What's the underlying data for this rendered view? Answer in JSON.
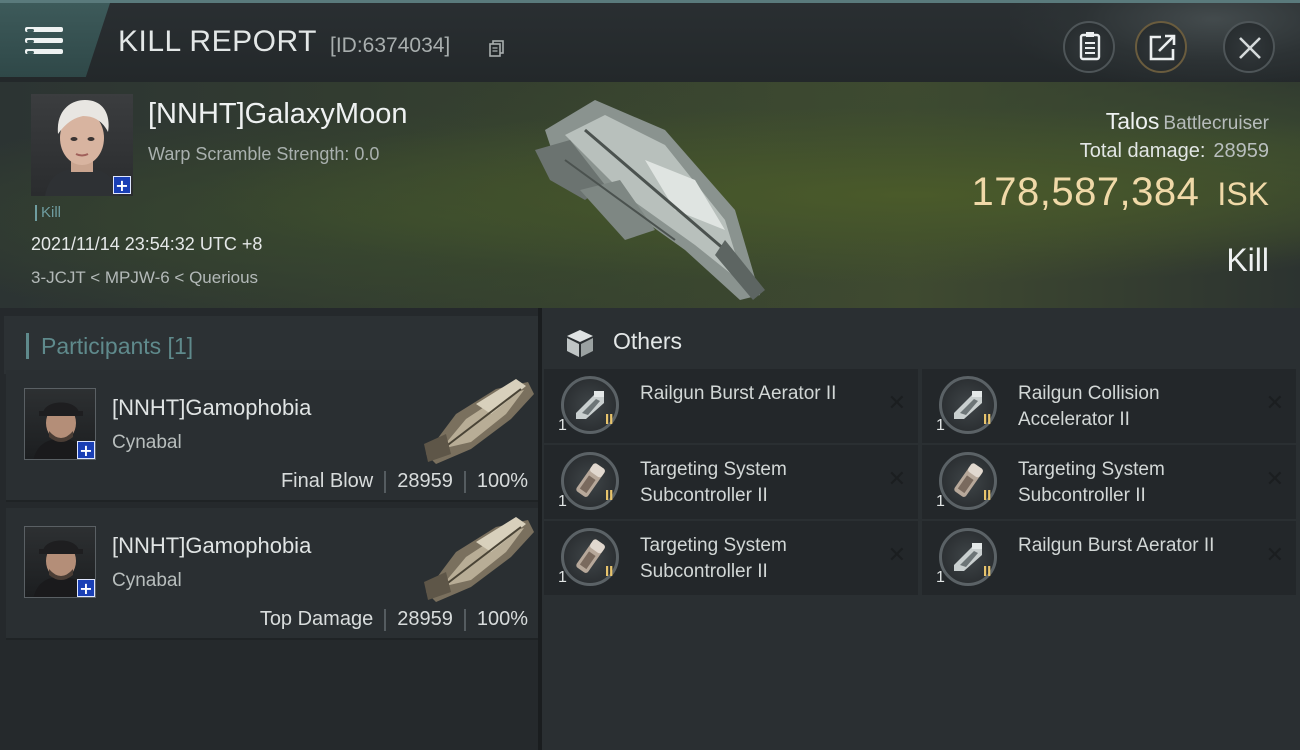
{
  "header": {
    "title": "KILL REPORT",
    "report_id": "[ID:6374034]",
    "icons": [
      "menu-icon",
      "copy-icon",
      "clipboard-icon",
      "share-icon",
      "close-icon"
    ]
  },
  "victim": {
    "name": "[NNHT]GalaxyMoon",
    "warp_scramble": "Warp Scramble Strength: 0.0",
    "tag": "Kill",
    "datetime": "2021/11/14 23:54:32 UTC +8",
    "route": "3-JCJT < MPJW-6 < Querious",
    "ship_name": "Talos",
    "ship_class": "Battlecruiser",
    "total_damage_label": "Total damage:",
    "total_damage": "28959",
    "isk_value": "178,587,384",
    "isk_unit": "ISK",
    "result": "Kill"
  },
  "participants": {
    "title": "Participants [1]",
    "rows": [
      {
        "name": "[NNHT]Gamophobia",
        "ship": "Cynabal",
        "role": "Final Blow",
        "damage": "28959",
        "percent": "100%"
      },
      {
        "name": "[NNHT]Gamophobia",
        "ship": "Cynabal",
        "role": "Top Damage",
        "damage": "28959",
        "percent": "100%"
      }
    ]
  },
  "others": {
    "title": "Others",
    "items": [
      {
        "name": "Railgun Burst Aerator II",
        "qty": "1",
        "tier": "II",
        "kind": "railgun"
      },
      {
        "name": "Railgun Collision Accelerator II",
        "qty": "1",
        "tier": "II",
        "kind": "railgun"
      },
      {
        "name": "Targeting System Subcontroller II",
        "qty": "1",
        "tier": "II",
        "kind": "targeting"
      },
      {
        "name": "Targeting System Subcontroller II",
        "qty": "1",
        "tier": "II",
        "kind": "targeting"
      },
      {
        "name": "Targeting System Subcontroller II",
        "qty": "1",
        "tier": "II",
        "kind": "targeting"
      },
      {
        "name": "Railgun Burst Aerator II",
        "qty": "1",
        "tier": "II",
        "kind": "railgun"
      }
    ],
    "remove_symbol": "✕"
  },
  "colors": {
    "accent_teal": "#5f8a8c",
    "isk_gold": "#f0d9a8",
    "tier_gold": "#e8c46c",
    "badge_blue": "#1a3fb5"
  }
}
